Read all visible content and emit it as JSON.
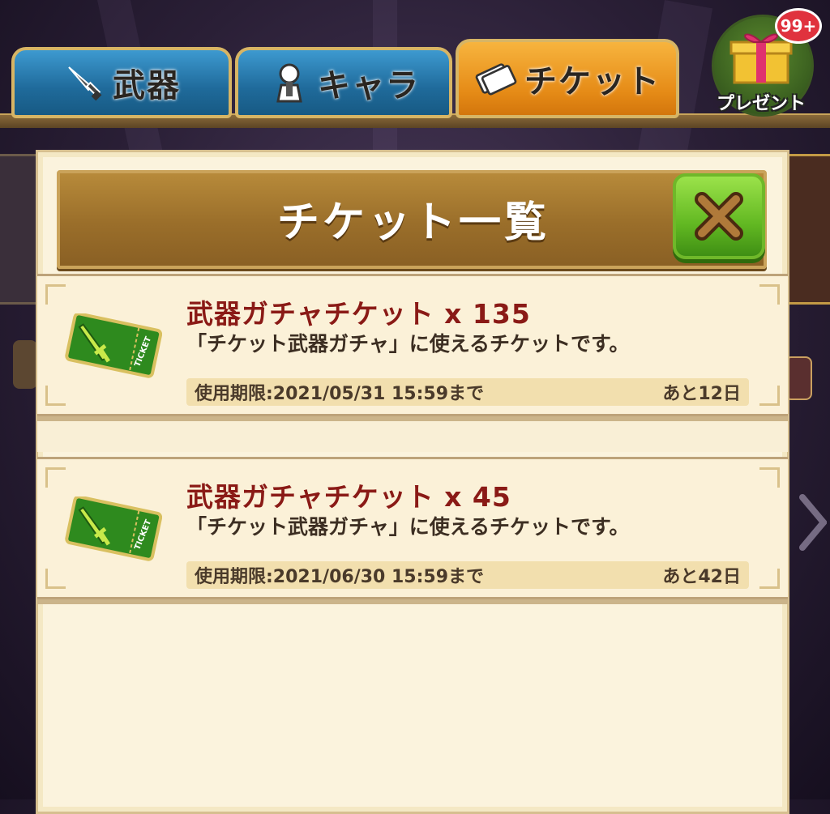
{
  "tabs": [
    {
      "label": "武器",
      "icon": "sword-icon",
      "active": false
    },
    {
      "label": "キャラ",
      "icon": "character-icon",
      "active": false
    },
    {
      "label": "チケット",
      "icon": "ticket-icon",
      "active": true
    }
  ],
  "present": {
    "label": "プレゼント",
    "badge": "99+"
  },
  "panel": {
    "title": "チケット一覧"
  },
  "tickets": [
    {
      "name": "武器ガチャチケット x 135",
      "description": "「チケット武器ガチャ」に使えるチケットです。",
      "expiry": "使用期限:2021/05/31  15:59まで",
      "remaining": "あと12日"
    },
    {
      "name": "武器ガチャチケット x 45",
      "description": "「チケット武器ガチャ」に使えるチケットです。",
      "expiry": "使用期限:2021/06/30  15:59まで",
      "remaining": "あと42日"
    }
  ],
  "colors": {
    "tab_blue": "#1f6a9a",
    "tab_orange": "#e58a16",
    "title_red": "#8a1a16",
    "close_green": "#62b822"
  }
}
